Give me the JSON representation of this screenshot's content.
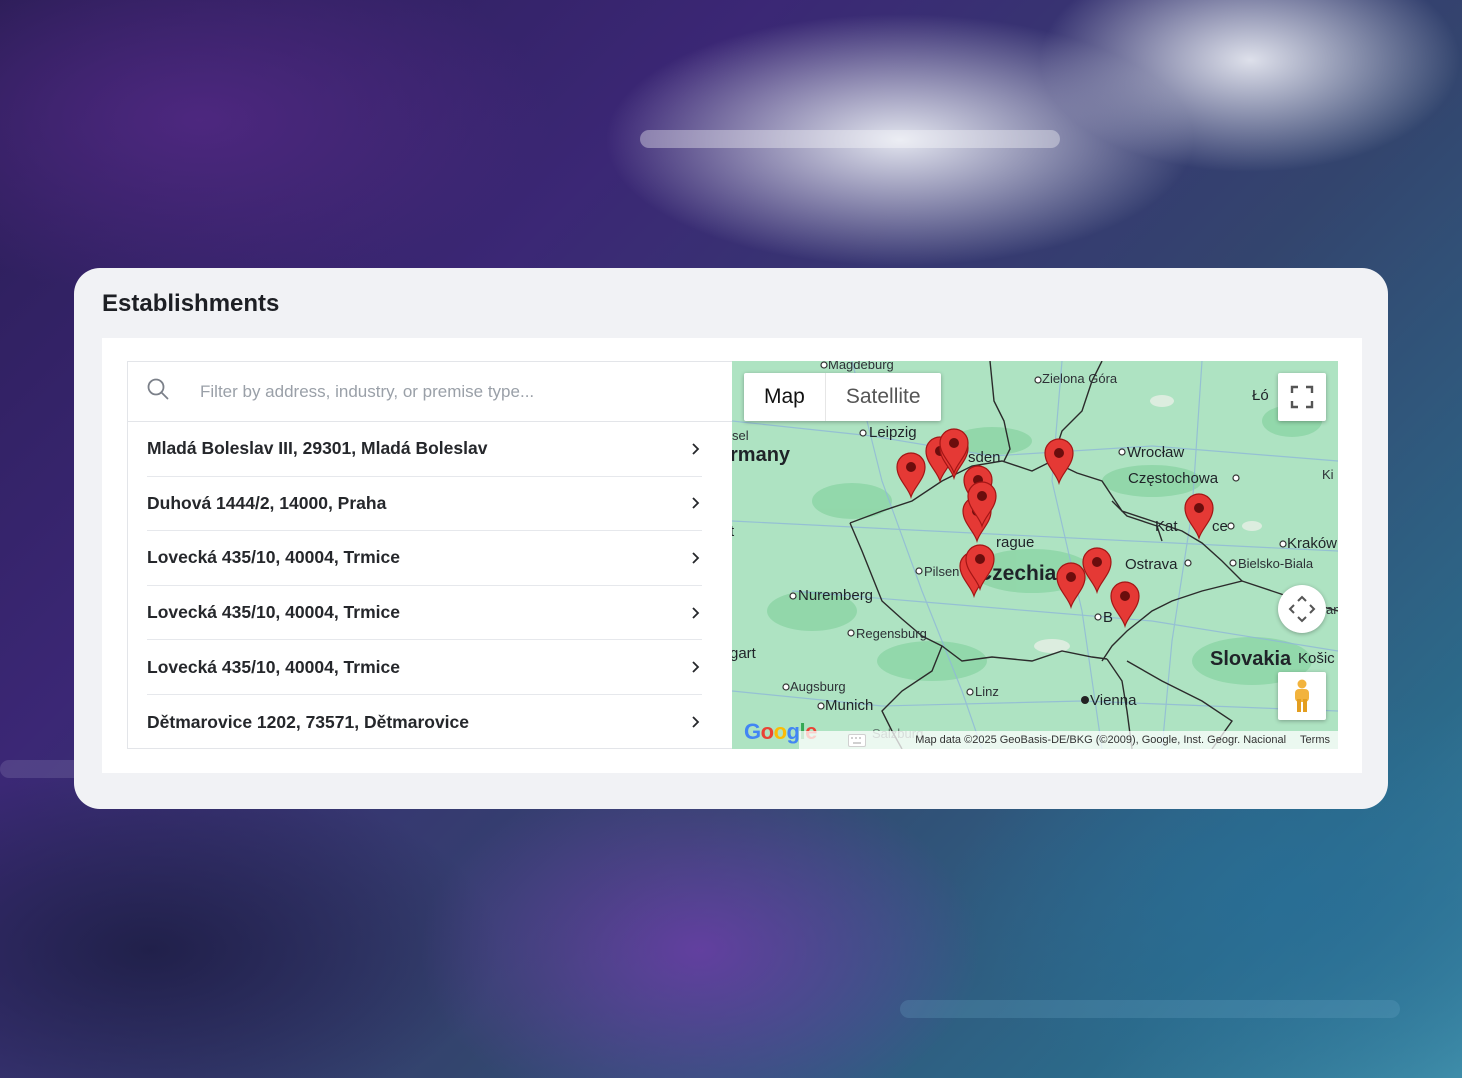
{
  "card": {
    "title": "Establishments"
  },
  "search": {
    "placeholder": "Filter by address, industry, or premise type..."
  },
  "establishments": [
    {
      "label": "Mladá Boleslav III, 29301, Mladá Boleslav"
    },
    {
      "label": "Duhová 1444/2, 14000, Praha"
    },
    {
      "label": "Lovecká 435/10, 40004, Trmice"
    },
    {
      "label": "Lovecká 435/10, 40004, Trmice"
    },
    {
      "label": "Lovecká 435/10, 40004, Trmice"
    },
    {
      "label": "Dětmarovice 1202, 73571, Dětmarovice"
    }
  ],
  "map": {
    "type_map": "Map",
    "type_satellite": "Satellite",
    "labels": {
      "magdeburg": "Magdeburg",
      "zielona_gora": "Zielona Góra",
      "lodz": "Łó",
      "kassel": "sel",
      "leipzig": "Leipzig",
      "germany": "rmany",
      "dresden": "sden",
      "wroclaw": "Wrocław",
      "czestochowa": "Częstochowa",
      "kielce": "Ki",
      "t": "t",
      "katowice": "Kat",
      "katowice_end": "ce",
      "prague": "rague",
      "krakow": "Kraków",
      "ostrava": "Ostrava",
      "bielsko": "Bielsko-Biala",
      "pilsen": "Pilsen",
      "czechia": "Czechia",
      "nuremberg": "Nuremberg",
      "an": "an",
      "regensburg": "Regensburg",
      "stuttgart": "gart",
      "slovakia": "Slovakia",
      "kosice": "Košic",
      "augsburg": "Augsburg",
      "linz": "Linz",
      "munich": "Munich",
      "vienna": "Vienna",
      "brno": "B",
      "salzburg": "Salzburg"
    },
    "logo": "Google",
    "attribution": "Map data ©2025 GeoBasis-DE/BKG (©2009), Google, Inst. Geogr. Nacional",
    "terms": "Terms",
    "marker_count": 14,
    "colors": {
      "marker": "#e53935",
      "land": "#aee3c2",
      "border": "#2b2b2b"
    }
  }
}
